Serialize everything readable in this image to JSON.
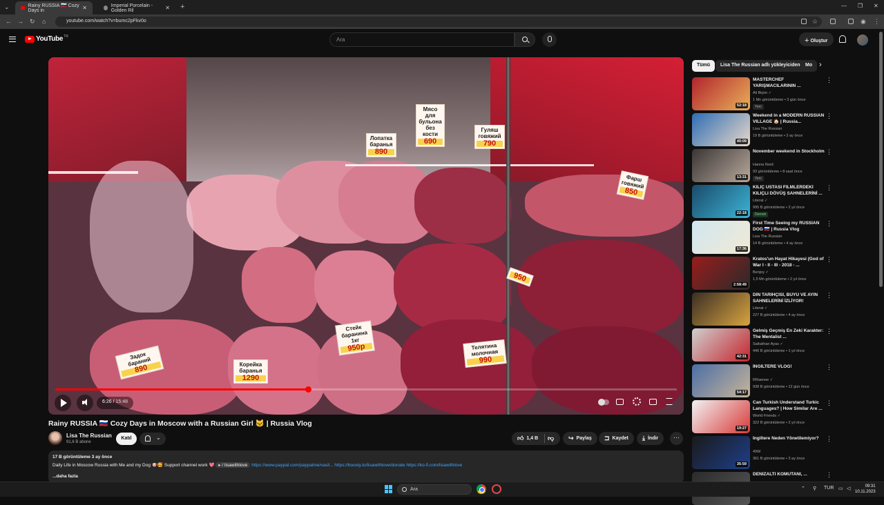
{
  "browser": {
    "tabs": [
      {
        "label": "Rainy RUSSIA 🇷🇺 Cozy Days in",
        "active": true
      },
      {
        "label": "Imperial Porcelain - Golden Ril",
        "active": false
      }
    ],
    "url": "youtube.com/watch?v=bumc2pFkv0o"
  },
  "header": {
    "logo_text": "YouTube",
    "logo_region": "TR",
    "search_placeholder": "Ara",
    "create_label": "Oluştur"
  },
  "player": {
    "current_time": "6:26",
    "duration": "15:48",
    "progress_fraction": 0.407,
    "signs": [
      {
        "text": "Лопатка баранья",
        "price": "890"
      },
      {
        "text": "Мясо для бульона без кости",
        "price": "690"
      },
      {
        "text": "Гуляш говяжий",
        "price": "790"
      },
      {
        "text": "Фарш говяжий",
        "price": "850"
      },
      {
        "text": "Стейк баранина 1кг",
        "price": "950р"
      },
      {
        "text": "Корейка баранья",
        "price": "1290"
      },
      {
        "text": "Задок бараний",
        "price": "890"
      },
      {
        "text": "Телятина молочная",
        "price": "990"
      },
      {
        "text": "",
        "price": "950"
      }
    ]
  },
  "video": {
    "title": "Rainy RUSSIA 🇷🇺 Cozy Days in Moscow with a Russian Girl 🐱 | Russia Vlog",
    "channel_name": "Lisa The Russian",
    "subscribers": "91,6 B abone",
    "join_label": "Katıl",
    "like_count": "1,4 B",
    "share_label": "Paylaş",
    "save_label": "Kaydet",
    "download_label": "İndir",
    "more_label": "⋯"
  },
  "description": {
    "stats": "17 B görüntüleme  3 ay önce",
    "text": "Daily Life in Moscow Russia with Me and my Dog 🐶🥰 Support channel work 💖 ",
    "tag": "▸ / lisawithlove",
    "link1": "https://www.paypal.com/paypalme/vasil...",
    "link2": "https://boosty.to/lisawithlove/donate",
    "link3": "https://ko-fi.com/lisawithlove",
    "more_label": "...daha fazla"
  },
  "sidebar": {
    "chips": [
      "Tümü",
      "Lisa The Russian adlı yükleyiciden",
      "Mo"
    ],
    "items": [
      {
        "title": "MASTERCHEF YARIŞMACILARININ ...",
        "channel": "Ali Biçim ✓",
        "meta": "1 Mn görüntüleme • 3 gün önce",
        "badge": "Yeni",
        "duration": "52:18",
        "colors": [
          "#b3242d",
          "#e8b15a"
        ]
      },
      {
        "title": "Weekend in a MODERN RUSSIAN VILLAGE 🏠 | Russia...",
        "channel": "Lisa The Russian",
        "meta": "19 B görüntüleme • 3 ay önce",
        "badge": "",
        "duration": "40:09",
        "colors": [
          "#2e6db4",
          "#e9d8c9"
        ]
      },
      {
        "title": "November weekend in Stockholm",
        "channel": "Hanna Nord",
        "meta": "93 görüntüleme • 8 saat önce",
        "badge": "Yeni",
        "duration": "13:31",
        "colors": [
          "#3a3634",
          "#b8a89c"
        ]
      },
      {
        "title": "KILIÇ USTASI FİLMLERDEKİ KILIÇLI DÖVÜŞ SAHNELERİNİ ...",
        "channel": "Literat ✓",
        "meta": "995 B görüntüleme • 2 yıl önce",
        "badge": "Dernek",
        "badge_green": true,
        "duration": "22:18",
        "colors": [
          "#1a4a6a",
          "#3db4d6"
        ]
      },
      {
        "title": "First Time Seeing my RUSSIAN DOG 🇷🇺 | Russia Vlog",
        "channel": "Lisa The Russian",
        "meta": "14 B görüntüleme • 4 ay önce",
        "badge": "",
        "duration": "17:36",
        "colors": [
          "#d0e8f2",
          "#f2e9d2"
        ]
      },
      {
        "title": "Kratos'un Hayat Hikayesi (God of War I - II - III - 2018 - ...",
        "channel": "Benjoy ✓",
        "meta": "1,5 Mn görüntüleme • 2 yıl önce",
        "badge": "",
        "duration": "2:58:49",
        "colors": [
          "#9a1c1c",
          "#2a2a2a"
        ]
      },
      {
        "title": "DİN TARİHÇİSİ, BÜYÜ VE AYİN SAHNELERİNİ İZLİYOR!",
        "channel": "Literat ✓",
        "meta": "227 B görüntüleme • 4 ay önce",
        "badge": "",
        "duration": "",
        "colors": [
          "#3a2e24",
          "#d9a441"
        ]
      },
      {
        "title": "Gelmiş Geçmiş En Zeki Karakter: The Mentalist ...",
        "channel": "Saltukhan Ayas ✓",
        "meta": "446 B görüntüleme • 1 yıl önce",
        "badge": "",
        "duration": "42:31",
        "colors": [
          "#cfcfcf",
          "#c4262e"
        ]
      },
      {
        "title": "İNGİLTERE VLOG!",
        "channel": "RRaenee ✓",
        "meta": "938 B görüntüleme • 12 gün önce",
        "badge": "",
        "duration": "54:17",
        "colors": [
          "#4b6fa6",
          "#c8b49a"
        ]
      },
      {
        "title": "Can Turkish Understand Turkic Languages? | How Similar Are ...",
        "channel": "World Friends ✓",
        "meta": "322 B görüntüleme • 2 yıl önce",
        "badge": "",
        "duration": "19:27",
        "colors": [
          "#f2f2f2",
          "#d83a3a"
        ]
      },
      {
        "title": "İngiltere Neden Yönetilemiyor?",
        "channel": "49W",
        "meta": "361 B görüntüleme • 3 ay önce",
        "badge": "",
        "duration": "35:59",
        "colors": [
          "#1a1a1a",
          "#1e3f8a"
        ]
      },
      {
        "title": "DENİZALTI KOMUTANI, ...",
        "channel": "",
        "meta": "",
        "badge": "",
        "duration": "",
        "colors": [
          "#2b2b2b",
          "#555555"
        ]
      }
    ]
  },
  "taskbar": {
    "search_placeholder": "Ara",
    "language": "TUR",
    "time": "09:31",
    "date": "10.11.2023"
  }
}
